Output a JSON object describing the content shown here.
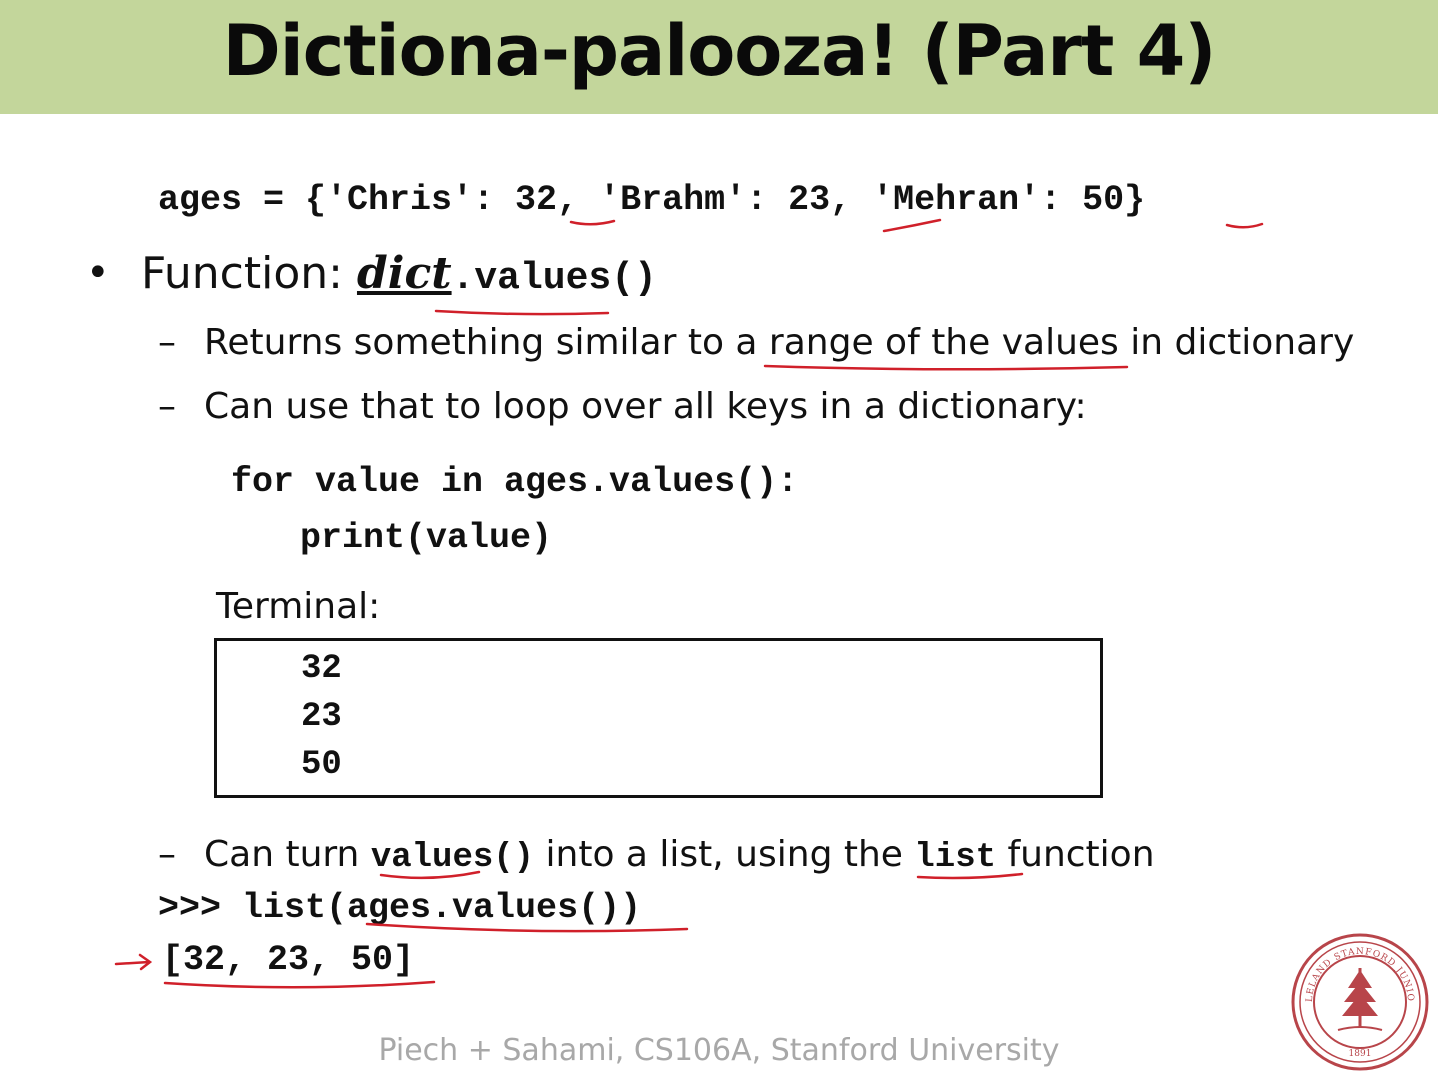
{
  "slide": {
    "title": "Dictiona-palooza!  (Part 4)",
    "ages_code": "ages = {'Chris': 32, 'Brahm': 23, 'Mehran': 50}",
    "bullet": {
      "symbol": "•",
      "prefix": "Function: ",
      "dict_word": "dict",
      "method": ".values()"
    },
    "dash": "–",
    "sub_points": [
      "Returns something similar to a range of the values in dictionary",
      "Can use that to loop over all keys in a dictionary:"
    ],
    "loop_code": [
      "for value in ages.values():",
      "print(value)"
    ],
    "terminal_label": "Terminal:",
    "terminal_lines": [
      "32",
      "23",
      "50"
    ],
    "turn_point": {
      "text_a": "Can turn ",
      "code_a": "values()",
      "text_b": " into a list, using the ",
      "code_b": "list",
      "text_c": " function"
    },
    "repl_input": ">>> list(ages.values())",
    "repl_output": "[32, 23, 50]",
    "footer": "Piech + Sahami, CS106A, Stanford University",
    "colors": {
      "header_bg": "#c3d69b",
      "annotation_red": "#d0202a",
      "seal_red": "#b8454a",
      "footer_gray": "#a8a8a8"
    }
  }
}
